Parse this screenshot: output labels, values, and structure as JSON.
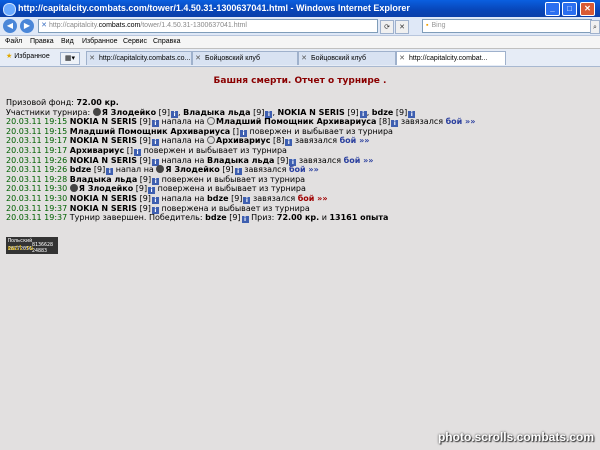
{
  "window": {
    "title": "http://capitalcity.combats.com/tower/1.4.50.31-1300637041.html - Windows Internet Explorer"
  },
  "address": {
    "prefix": "http://capitalcity.",
    "domain": "combats.com",
    "path": "/tower/1.4.50.31-1300637041.html"
  },
  "search": {
    "placeholder": "Bing"
  },
  "menu": [
    "Файл",
    "Правка",
    "Вид",
    "Избранное",
    "Сервис",
    "Справка"
  ],
  "favorites_label": "Избранное",
  "tabs": [
    {
      "label": "http://capitalcity.combats.co..."
    },
    {
      "label": "Бойцовский клуб"
    },
    {
      "label": "Бойцовский клуб"
    },
    {
      "label": "http://capitalcity.combat..."
    }
  ],
  "page": {
    "title": "Башня смерти. Отчет о турнире .",
    "prize_label": "Призовой фонд:",
    "prize_value": "72.00 кр.",
    "participants_label": "Участники турнира:",
    "participants": [
      {
        "name": "Я Злодейко",
        "level": "[9]"
      },
      {
        "name": "Владыка льда",
        "level": "[9]"
      },
      {
        "name": "NOKIA N SERIS",
        "level": "[9]"
      },
      {
        "name": "bdze",
        "level": "[9]"
      }
    ],
    "info_glyph": "i",
    "log": [
      {
        "time": "20.03.11 19:15",
        "a": "NOKIA N SERIS",
        "al": "[9]",
        "verb": "напала на",
        "b": "Младший Помощник Архивариуса",
        "bl": "[8]",
        "tail": "завязался",
        "link": "бой »»"
      },
      {
        "time": "20.03.11 19:15",
        "a": "Младший Помощник Архивариуса",
        "al": "[]",
        "tail": "повержен и выбывает из турнира"
      },
      {
        "time": "20.03.11 19:17",
        "a": "NOKIA N SERIS",
        "al": "[9]",
        "verb": "напала на",
        "b": "Архивариус",
        "bl": "[8]",
        "tail": "завязался",
        "link": "бой »»"
      },
      {
        "time": "20.03.11 19:17",
        "a": "Архивариус",
        "al": "[]",
        "tail": "повержен и выбывает из турнира"
      },
      {
        "time": "20.03.11 19:26",
        "a": "NOKIA N SERIS",
        "al": "[9]",
        "verb": "напала на",
        "b": "Владыка льда",
        "bl": "[9]",
        "tail": "завязался",
        "link": "бой »»"
      },
      {
        "time": "20.03.11 19:26",
        "a": "bdze",
        "al": "[9]",
        "verb": "напал на",
        "b": "Я Злодейко",
        "bl": "[9]",
        "tail": "завязался",
        "link": "бой »»"
      },
      {
        "time": "20.03.11 19:28",
        "a": "Владыка льда",
        "al": "[9]",
        "tail": "повержен и выбывает из турнира"
      },
      {
        "time": "20.03.11 19:30",
        "a": "Я Злодейко",
        "al": "[9]",
        "tail": "повержена и выбывает из турнира"
      },
      {
        "time": "20.03.11 19:30",
        "a": "NOKIA N SERIS",
        "al": "[9]",
        "verb": "напала на",
        "b": "bdze",
        "bl": "[9]",
        "tail": "завязался",
        "link": "бой »»"
      },
      {
        "time": "20.03.11 19:37",
        "a": "NOKIA N SERIS",
        "al": "[9]",
        "tail": "повержена и выбывает из турнира"
      },
      {
        "time": "20.03.11 19:37",
        "text": "Турнир завершен. Победитель:",
        "a": "bdze",
        "al": "[9]",
        "prize_label": "Приз:",
        "prize": "72.00 кр.",
        "and": "и",
        "exp": "13161 опыта"
      }
    ],
    "counter": {
      "top": "Польский 28772056",
      "logo": "mail.ru",
      "n1": "8136628",
      "n2": "24883"
    }
  },
  "watermark": "photo.scrolls.combats.com"
}
